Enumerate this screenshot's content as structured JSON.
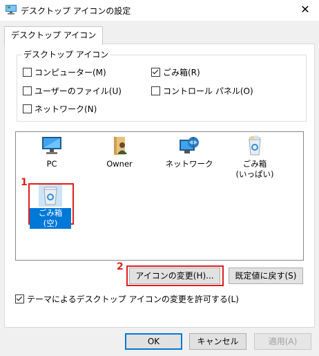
{
  "window": {
    "title": "デスクトップ アイコンの設定",
    "close_glyph": "✕"
  },
  "tab": {
    "label": "デスクトップ アイコン"
  },
  "group": {
    "legend": "デスクトップ アイコン",
    "checkboxes": [
      {
        "label": "コンピューター(M)",
        "checked": false
      },
      {
        "label": "ごみ箱(R)",
        "checked": true
      },
      {
        "label": "ユーザーのファイル(U)",
        "checked": false
      },
      {
        "label": "コントロール パネル(O)",
        "checked": false
      },
      {
        "label": "ネットワーク(N)",
        "checked": false
      }
    ]
  },
  "icons": [
    {
      "label": "PC",
      "icon": "pc-icon"
    },
    {
      "label": "Owner",
      "icon": "user-folder-icon"
    },
    {
      "label": "ネットワーク",
      "icon": "network-icon"
    },
    {
      "label": "ごみ箱\n(いっぱい)",
      "line1": "ごみ箱",
      "line2": "(いっぱい)",
      "icon": "recycle-bin-full-icon"
    },
    {
      "label": "ごみ箱 (空)",
      "icon": "recycle-bin-empty-icon",
      "selected": true
    }
  ],
  "buttons": {
    "change_icon": "アイコンの変更(H)...",
    "restore_default": "既定値に戻す(S)",
    "ok": "OK",
    "cancel": "キャンセル",
    "apply": "適用(A)"
  },
  "theme_checkbox": {
    "label": "テーマによるデスクトップ アイコンの変更を許可する(L)",
    "checked": true
  },
  "annotations": {
    "step1": "1",
    "step2": "2"
  },
  "colors": {
    "accent": "#0078d7",
    "annotation_red": "#e01c1c",
    "selection": "#0078d7"
  }
}
